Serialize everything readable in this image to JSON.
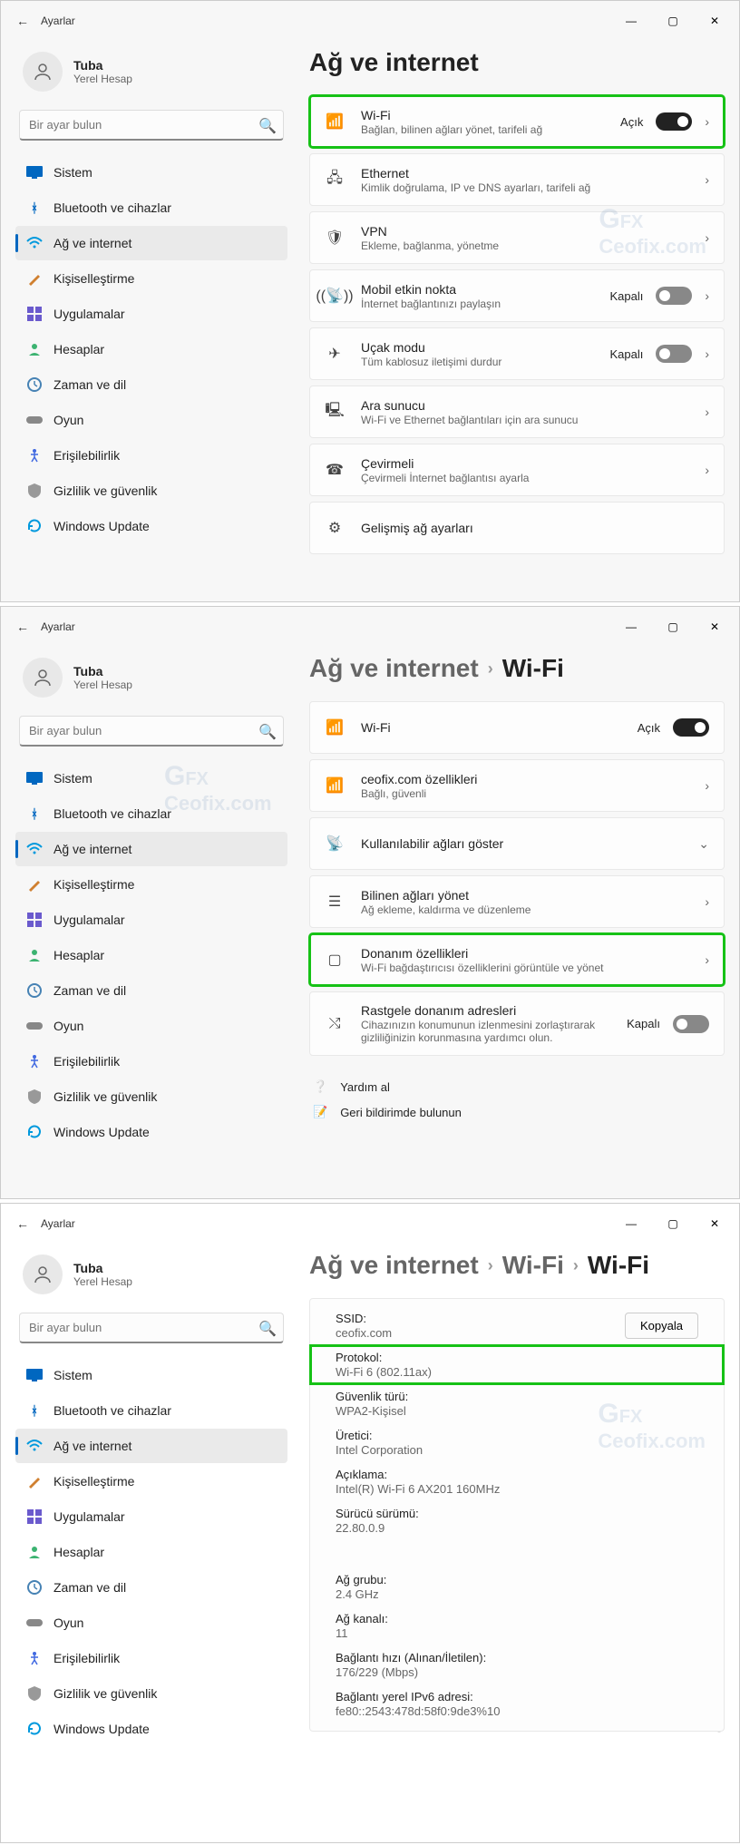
{
  "app_title": "Ayarlar",
  "user": {
    "name": "Tuba",
    "account_type": "Yerel Hesap"
  },
  "search_placeholder": "Bir ayar bulun",
  "nav": [
    {
      "key": "system",
      "label": "Sistem"
    },
    {
      "key": "bluetooth",
      "label": "Bluetooth ve cihazlar"
    },
    {
      "key": "network",
      "label": "Ağ ve internet"
    },
    {
      "key": "personalization",
      "label": "Kişiselleştirme"
    },
    {
      "key": "apps",
      "label": "Uygulamalar"
    },
    {
      "key": "accounts",
      "label": "Hesaplar"
    },
    {
      "key": "time",
      "label": "Zaman ve dil"
    },
    {
      "key": "gaming",
      "label": "Oyun"
    },
    {
      "key": "accessibility",
      "label": "Erişilebilirlik"
    },
    {
      "key": "privacy",
      "label": "Gizlilik ve güvenlik"
    },
    {
      "key": "update",
      "label": "Windows Update"
    }
  ],
  "page1": {
    "title": "Ağ ve internet",
    "items": [
      {
        "title": "Wi-Fi",
        "sub": "Bağlan, bilinen ağları yönet, tarifeli ağ",
        "state": "Açık",
        "toggle": "on",
        "chev": true,
        "highlight": true
      },
      {
        "title": "Ethernet",
        "sub": "Kimlik doğrulama, IP ve DNS ayarları, tarifeli ağ",
        "chev": true
      },
      {
        "title": "VPN",
        "sub": "Ekleme, bağlanma, yönetme",
        "chev": true
      },
      {
        "title": "Mobil etkin nokta",
        "sub": "İnternet bağlantınızı paylaşın",
        "state": "Kapalı",
        "toggle": "off",
        "chev": true
      },
      {
        "title": "Uçak modu",
        "sub": "Tüm kablosuz iletişimi durdur",
        "state": "Kapalı",
        "toggle": "off",
        "chev": true
      },
      {
        "title": "Ara sunucu",
        "sub": "Wi-Fi ve Ethernet bağlantıları için ara sunucu",
        "chev": true
      },
      {
        "title": "Çevirmeli",
        "sub": "Çevirmeli İnternet bağlantısı ayarla",
        "chev": true
      },
      {
        "title": "Gelişmiş ağ ayarları",
        "sub": ""
      }
    ]
  },
  "page2": {
    "crumb1": "Ağ ve internet",
    "crumb2": "Wi-Fi",
    "items": [
      {
        "title": "Wi-Fi",
        "sub": "",
        "state": "Açık",
        "toggle": "on-dark"
      },
      {
        "title": "ceofix.com özellikleri",
        "sub": "Bağlı, güvenli",
        "chev": true
      },
      {
        "title": "Kullanılabilir ağları göster",
        "sub": "",
        "chev_down": true
      },
      {
        "title": "Bilinen ağları yönet",
        "sub": "Ağ ekleme, kaldırma ve düzenleme",
        "chev": true
      },
      {
        "title": "Donanım özellikleri",
        "sub": "Wi-Fi bağdaştırıcısı özelliklerini görüntüle ve yönet",
        "chev": true,
        "highlight": true
      },
      {
        "title": "Rastgele donanım adresleri",
        "sub": "Cihazınızın konumunun izlenmesini zorlaştırarak gizliliğinizin korunmasına yardımcı olun.",
        "state": "Kapalı",
        "toggle": "off"
      }
    ],
    "help": "Yardım al",
    "feedback": "Geri bildirimde bulunun"
  },
  "page3": {
    "crumb1": "Ağ ve internet",
    "crumb2": "Wi-Fi",
    "crumb3": "Wi-Fi",
    "copy": "Kopyala",
    "rows": [
      {
        "label": "SSID:",
        "value": "ceofix.com"
      },
      {
        "label": "Protokol:",
        "value": "Wi-Fi 6 (802.11ax)",
        "highlight": true
      },
      {
        "label": "Güvenlik türü:",
        "value": "WPA2-Kişisel"
      },
      {
        "label": "Üretici:",
        "value": "Intel Corporation"
      },
      {
        "label": "Açıklama:",
        "value": "Intel(R) Wi-Fi 6 AX201 160MHz"
      },
      {
        "label": "Sürücü sürümü:",
        "value": "22.80.0.9"
      }
    ],
    "rows2": [
      {
        "label": "Ağ grubu:",
        "value": "2.4 GHz"
      },
      {
        "label": "Ağ kanalı:",
        "value": "11"
      },
      {
        "label": "Bağlantı hızı (Alınan/İletilen):",
        "value": "176/229 (Mbps)"
      },
      {
        "label": "Bağlantı yerel IPv6 adresi:",
        "value": "fe80::2543:478d:58f0:9de3%10"
      }
    ]
  },
  "watermark": "Ceofix.com"
}
